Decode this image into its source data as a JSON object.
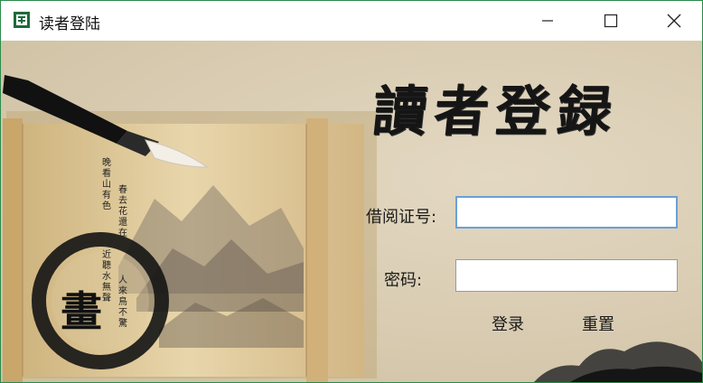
{
  "window": {
    "title": "读者登陆",
    "controls": {
      "minimize": "minimize",
      "maximize": "maximize",
      "close": "close"
    }
  },
  "heading": "讀者登録",
  "scroll_painting": {
    "badge_char": "畫",
    "poem_col1": "晚看山有色",
    "poem_col2": "春去花還在",
    "poem_col3": "近聽水無聲",
    "poem_col4": "人來鳥不驚"
  },
  "form": {
    "card_label": "借阅证号:",
    "card_value": "",
    "password_label": "密码:",
    "password_value": "",
    "login_button": "登录",
    "reset_button": "重置"
  },
  "colors": {
    "background": "#d9cdb4",
    "scroll": "#e2cfa4",
    "ink": "#151515"
  },
  "icons": [
    "app-icon",
    "minimize-icon",
    "maximize-icon",
    "close-icon",
    "brush-icon",
    "ink-circle-icon"
  ]
}
